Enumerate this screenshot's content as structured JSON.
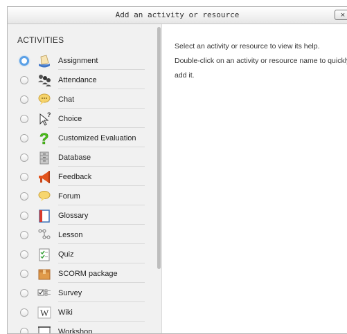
{
  "dialog": {
    "title": "Add an activity or resource",
    "close_label": "×"
  },
  "activities": {
    "section_title": "ACTIVITIES",
    "items": [
      {
        "label": "Assignment",
        "icon": "assignment-icon",
        "selected": true
      },
      {
        "label": "Attendance",
        "icon": "attendance-icon",
        "selected": false
      },
      {
        "label": "Chat",
        "icon": "chat-icon",
        "selected": false
      },
      {
        "label": "Choice",
        "icon": "choice-icon",
        "selected": false
      },
      {
        "label": "Customized Evaluation",
        "icon": "question-icon",
        "selected": false
      },
      {
        "label": "Database",
        "icon": "database-icon",
        "selected": false
      },
      {
        "label": "Feedback",
        "icon": "megaphone-icon",
        "selected": false
      },
      {
        "label": "Forum",
        "icon": "forum-icon",
        "selected": false
      },
      {
        "label": "Glossary",
        "icon": "book-icon",
        "selected": false
      },
      {
        "label": "Lesson",
        "icon": "lesson-icon",
        "selected": false
      },
      {
        "label": "Quiz",
        "icon": "quiz-icon",
        "selected": false
      },
      {
        "label": "SCORM package",
        "icon": "package-icon",
        "selected": false
      },
      {
        "label": "Survey",
        "icon": "survey-icon",
        "selected": false
      },
      {
        "label": "Wiki",
        "icon": "wiki-icon",
        "selected": false
      },
      {
        "label": "Workshop",
        "icon": "workshop-icon",
        "selected": false
      }
    ]
  },
  "help": {
    "line1": "Select an activity or resource to view its help.",
    "line2": "Double-click on an activity or resource name to quickly add it."
  }
}
